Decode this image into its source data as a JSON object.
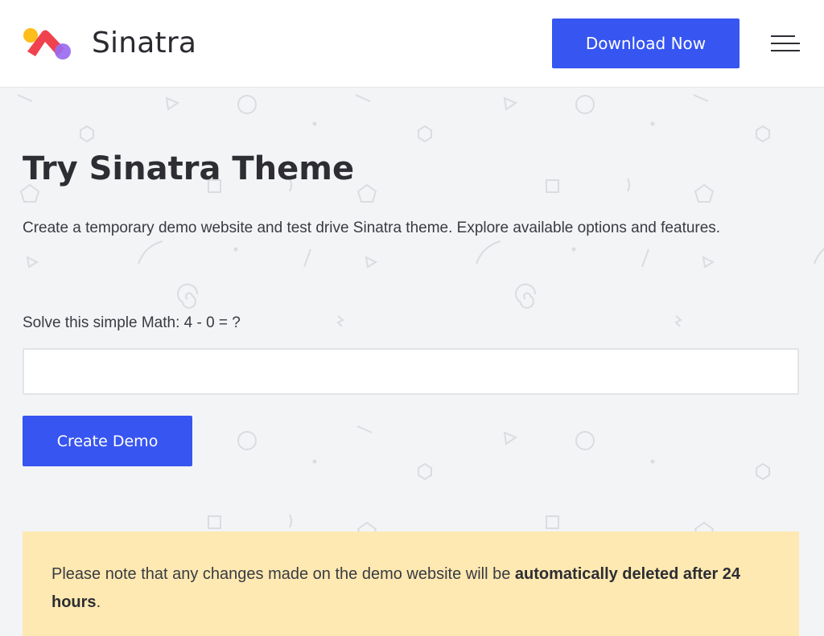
{
  "header": {
    "brand": "Sinatra",
    "download_label": "Download Now",
    "logo_colors": {
      "red": "#f0424e",
      "yellow": "#fdbd1b",
      "purple": "#9a6bf0"
    }
  },
  "main": {
    "title": "Try Sinatra Theme",
    "subtitle": "Create a temporary demo website and test drive Sinatra theme. Explore available options and features.",
    "math_label": "Solve this simple Math: 4 - 0 = ?",
    "answer_value": "",
    "create_label": "Create Demo"
  },
  "notice": {
    "text_before": "Please note that any changes made on the demo website will be ",
    "text_bold": "automatically deleted after 24 hours",
    "text_after": "."
  },
  "colors": {
    "accent": "#3755f0",
    "background": "#f3f4f6",
    "notice_bg": "#fde9b1"
  }
}
